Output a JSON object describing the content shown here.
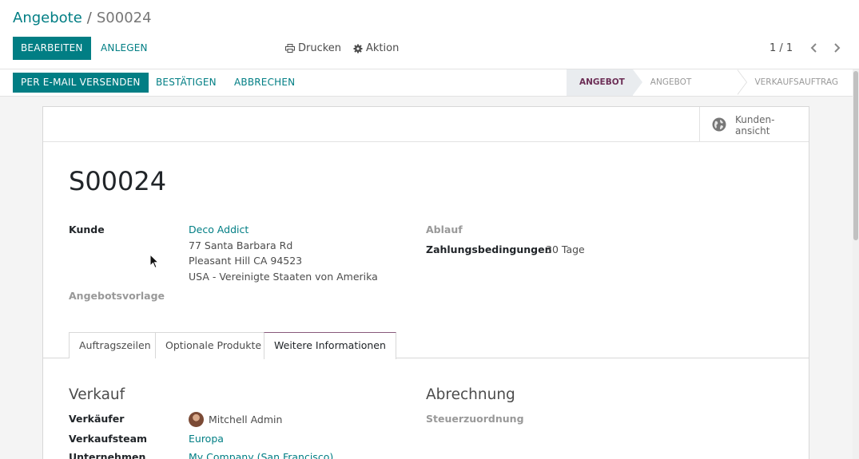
{
  "breadcrumb": {
    "parent": "Angebote",
    "separator": "/",
    "current": "S00024"
  },
  "toolbar": {
    "edit_label": "Bearbeiten",
    "create_label": "Anlegen",
    "print_label": "Drucken",
    "action_label": "Aktion",
    "pager": "1 / 1"
  },
  "statusbar": {
    "send_email": "Per E-Mail versenden",
    "confirm": "Bestätigen",
    "cancel": "Abbrechen",
    "stages": [
      {
        "label": "Angebot",
        "active": true
      },
      {
        "label": "Angebot gesendet",
        "active": false
      },
      {
        "label": "Verkaufsauftrag",
        "active": false
      }
    ]
  },
  "smart_button": {
    "line1": "Kunden-",
    "line2": "ansicht",
    "icon": "globe-icon"
  },
  "record": {
    "name": "S00024",
    "customer_label": "Kunde",
    "customer_name": "Deco Addict",
    "address_line1": "77 Santa Barbara Rd",
    "address_line2": "Pleasant Hill CA 94523",
    "address_line3": "USA - Vereinigte Staaten von Amerika",
    "template_label": "Angebotsvorlage",
    "expiry_label": "Ablauf",
    "payment_terms_label": "Zahlungsbedingungen",
    "payment_terms_value": "30 Tage"
  },
  "tabs": [
    {
      "label": "Auftragszeilen",
      "active": false
    },
    {
      "label": "Optionale Produkte",
      "active": false
    },
    {
      "label": "Weitere Informationen",
      "active": true
    }
  ],
  "other_info": {
    "sales_title": "Verkauf",
    "salesperson_label": "Verkäufer",
    "salesperson_value": "Mitchell Admin",
    "team_label": "Verkaufsteam",
    "team_value": "Europa",
    "company_label": "Unternehmen",
    "company_value": "My Company (San Francisco)",
    "invoicing_title": "Abrechnung",
    "fiscal_position_label": "Steuerzuordnung"
  },
  "colors": {
    "primary": "#017e84",
    "stage_active": "#6c2e56",
    "tab_accent": "#875a7b"
  }
}
